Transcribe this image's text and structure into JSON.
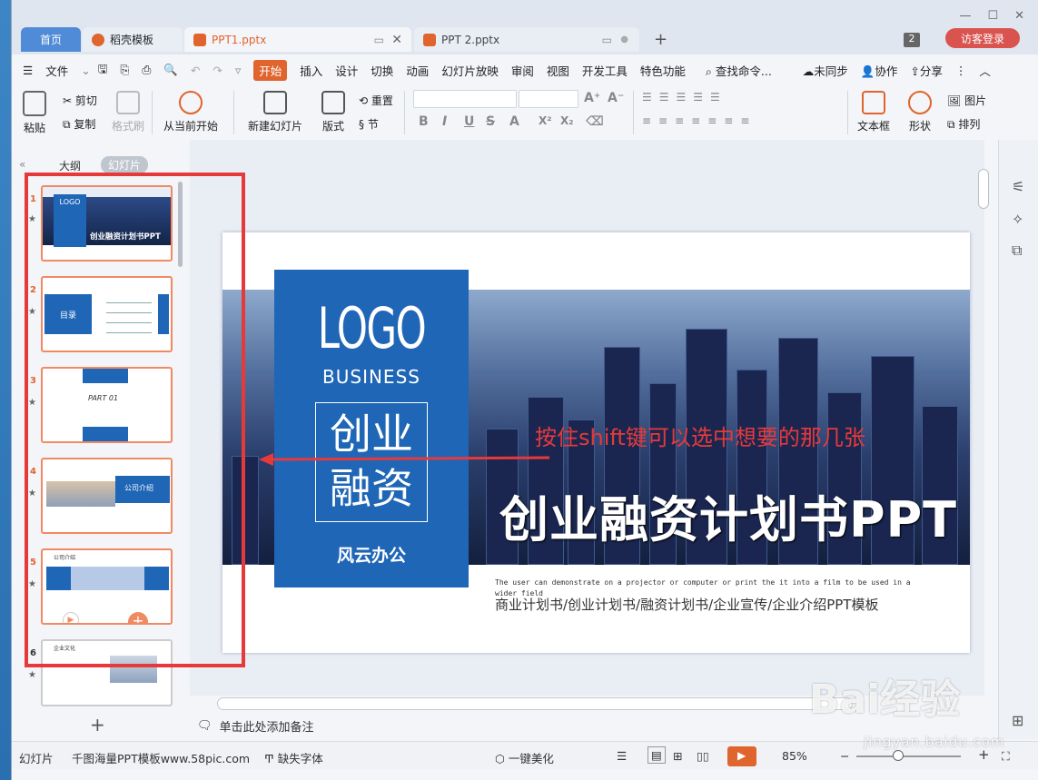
{
  "tabs": {
    "home": "首页",
    "daoke": "稻壳模板",
    "ppt1": "PPT1.pptx",
    "ppt2": "PPT 2.pptx"
  },
  "titlebar": {
    "window_count": "2",
    "login": "访客登录"
  },
  "menu": {
    "file": "文件",
    "items": [
      "开始",
      "插入",
      "设计",
      "切换",
      "动画",
      "幻灯片放映",
      "审阅",
      "视图",
      "开发工具",
      "特色功能"
    ],
    "search": "查找命令...",
    "sync": "未同步",
    "collab": "协作",
    "share": "分享"
  },
  "ribbon": {
    "paste": "粘贴",
    "cut": "剪切",
    "copy": "复制",
    "format_painter": "格式刷",
    "from_current": "从当前开始",
    "new_slide": "新建幻灯片",
    "layout": "版式",
    "reset": "重置",
    "section": "节",
    "textbox": "文本框",
    "shape": "形状",
    "picture": "图片",
    "arrange": "排列"
  },
  "left_panel": {
    "outline_tab": "大纲",
    "slides_tab": "幻灯片",
    "thumbs": [
      {
        "num": "1",
        "title": "创业融资计划书PPT"
      },
      {
        "num": "2",
        "title": "目录"
      },
      {
        "num": "3",
        "title": "PART 01"
      },
      {
        "num": "4",
        "title": "公司介绍"
      },
      {
        "num": "5",
        "title": "公司介绍"
      },
      {
        "num": "6",
        "title": "企业文化"
      }
    ]
  },
  "slide": {
    "logo": "LOGO",
    "business": "BUSINESS",
    "chuangye_line1": "创业",
    "chuangye_line2": "融资",
    "fengyun": "风云办公",
    "title": "创业融资计划书PPT",
    "english": "The user can demonstrate on a projector or computer or print the it into a film to be used in a wider field",
    "subtitle": "商业计划书/创业计划书/融资计划书/企业宣传/企业介绍PPT模板",
    "annotation": "按住shift键可以选中想要的那几张"
  },
  "notes": {
    "placeholder": "单击此处添加备注"
  },
  "status": {
    "slides": "幻灯片",
    "template": "千图海量PPT模板www.58pic.com",
    "missing_font": "缺失字体",
    "beautify": "一键美化",
    "zoom": "85%"
  },
  "watermark": {
    "brand": "Bai经验",
    "url": "jingyan.baidu.com"
  },
  "colors": {
    "accent": "#e0642e",
    "slide_blue": "#1f66b6",
    "annotation_red": "#e63a3a"
  }
}
